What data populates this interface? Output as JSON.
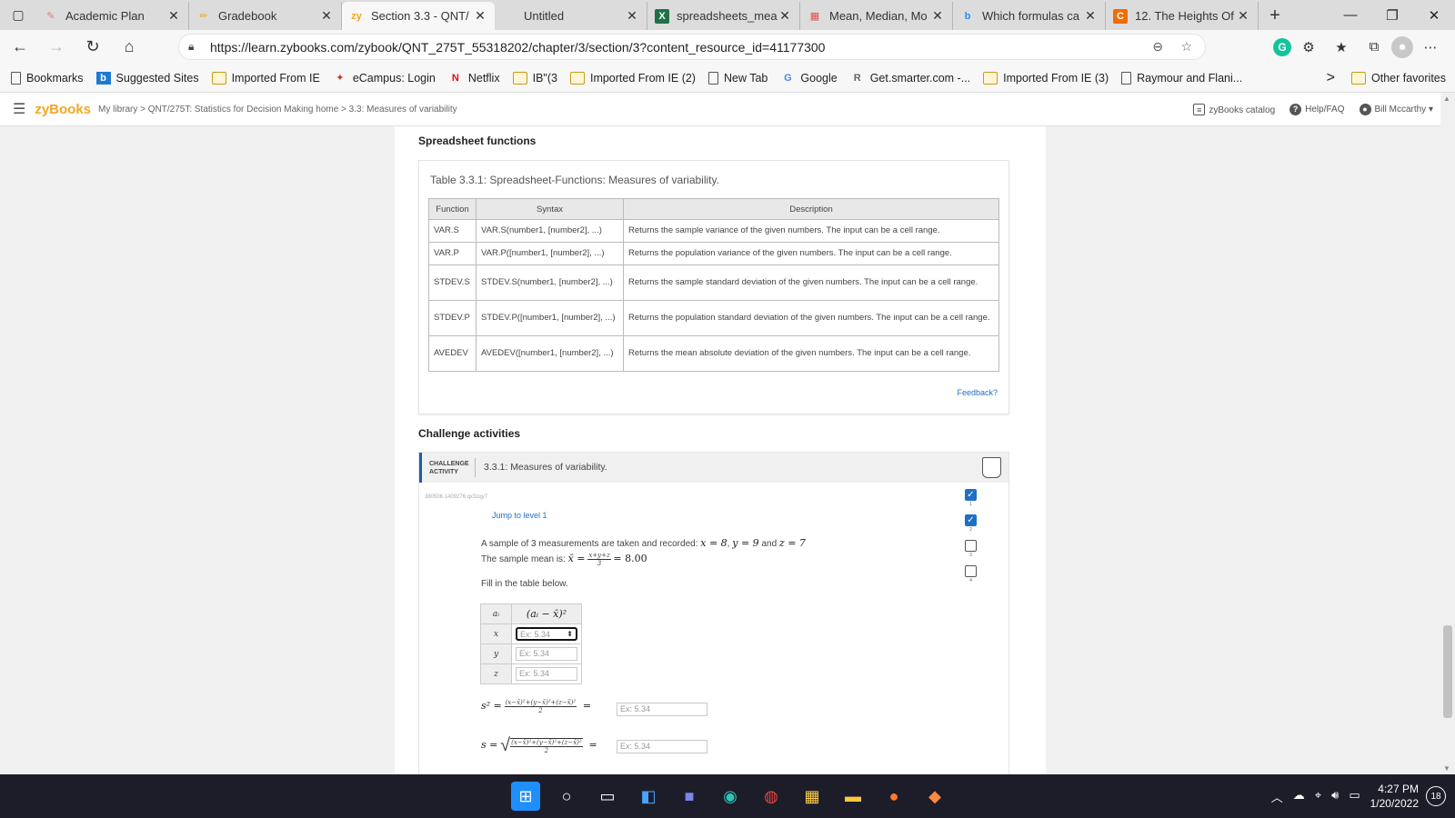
{
  "browser": {
    "tabs": [
      {
        "label": "Academic Plan",
        "icon": "feather-icon",
        "color": "#e07b7b"
      },
      {
        "label": "Gradebook",
        "icon": "pencil-icon",
        "color": "#f3a712"
      },
      {
        "label": "Section 3.3 - QNT/",
        "icon": "zy-icon",
        "color": "#f5a623",
        "active": true
      },
      {
        "label": "Untitled",
        "icon": "",
        "color": "#dcdcdc"
      },
      {
        "label": "spreadsheets_mea",
        "icon": "excel-icon",
        "color": "#1e7145"
      },
      {
        "label": "Mean, Median, Mo",
        "icon": "sheet-icon",
        "color": "#d9534f"
      },
      {
        "label": "Which formulas ca",
        "icon": "bing-icon",
        "color": "#2d8cf0"
      },
      {
        "label": "12. The Heights Of",
        "icon": "c-icon",
        "color": "#ef6c00"
      }
    ],
    "close_glyph": "✕",
    "new_tab_glyph": "+",
    "url": "https://learn.zybooks.com/zybook/QNT_275T_55318202/chapter/3/section/3?content_resource_id=41177300",
    "bookmarks": [
      {
        "label": "Bookmarks",
        "type": "page"
      },
      {
        "label": "Suggested Sites",
        "type": "bing"
      },
      {
        "label": "Imported From IE",
        "type": "folder"
      },
      {
        "label": "eCampus: Login",
        "type": "phoenix"
      },
      {
        "label": "Netflix",
        "type": "netflix"
      },
      {
        "label": "IB\"(3",
        "type": "folder"
      },
      {
        "label": "Imported From IE (2)",
        "type": "folder"
      },
      {
        "label": "New Tab",
        "type": "page"
      },
      {
        "label": "Google",
        "type": "google"
      },
      {
        "label": "Get.smarter.com -...",
        "type": "r"
      },
      {
        "label": "Imported From IE (3)",
        "type": "folder"
      },
      {
        "label": "Raymour and Flani...",
        "type": "page"
      }
    ],
    "bookmarks_more": ">",
    "other_favorites": "Other favorites"
  },
  "zy": {
    "logo": "zyBooks",
    "breadcrumb": "My library > QNT/275T: Statistics for Decision Making home > 3.3: Measures of variability",
    "catalog": "zyBooks catalog",
    "help": "Help/FAQ",
    "user": "Bill Mccarthy"
  },
  "content": {
    "spreadsheet_heading": "Spreadsheet functions",
    "table_caption": "Table 3.3.1: Spreadsheet-Functions: Measures of variability.",
    "table_headers": [
      "Function",
      "Syntax",
      "Description"
    ],
    "table_rows": [
      {
        "fn": "VAR.S",
        "syntax": "VAR.S(number1, [number2], ...)",
        "desc": "Returns the sample variance of the given numbers. The input can be a cell range."
      },
      {
        "fn": "VAR.P",
        "syntax": "VAR.P([number1, [number2], ...)",
        "desc": "Returns the population variance of the given numbers. The input can be a cell range."
      },
      {
        "fn": "STDEV.S",
        "syntax": "STDEV.S(number1, [number2], ...)",
        "desc": "Returns the sample standard deviation of the given numbers. The input can be a cell range."
      },
      {
        "fn": "STDEV.P",
        "syntax": "STDEV.P([number1, [number2], ...)",
        "desc": "Returns the population standard deviation of the given numbers. The input can be a cell range."
      },
      {
        "fn": "AVEDEV",
        "syntax": "AVEDEV([number1, [number2], ...)",
        "desc": "Returns the mean absolute deviation of the given numbers. The input can be a cell range."
      }
    ],
    "feedback": "Feedback?",
    "challenge_heading": "Challenge activities",
    "challenge_tag_1": "CHALLENGE",
    "challenge_tag_2": "ACTIVITY",
    "challenge_title": "3.3.1: Measures of variability.",
    "challenge_id": "380506.1409276.qx3zqy7",
    "jump": "Jump to level 1",
    "prob_line1": "A sample of 3 measurements are taken and recorded:",
    "x_val": "x = 8",
    "y_val": "y = 9",
    "and_word": "and",
    "z_val": "z = 7",
    "prob_line2": "The sample mean is:",
    "mean_lhs": "x̄ =",
    "mean_num": "x+y+z",
    "mean_den": "3",
    "mean_result": "= 8.00",
    "fill": "Fill in the table below.",
    "tbl_col1": "aᵢ",
    "tbl_col2": "(aᵢ − x̄)²",
    "tbl_vars": [
      "x",
      "y",
      "z"
    ],
    "placeholder": "Ex: 5.34",
    "s2_lhs": "s² =",
    "s2_num": "(x−x̄)²+(y−x̄)²+(z−x̄)²",
    "s2_den": "2",
    "eq": "=",
    "s_lhs": "s =",
    "levels": [
      {
        "num": "1",
        "done": true
      },
      {
        "num": "2",
        "done": true
      },
      {
        "num": "3",
        "done": false
      },
      {
        "num": "4",
        "done": false
      }
    ]
  },
  "taskbar": {
    "time": "4:27 PM",
    "date": "1/20/2022",
    "notifications": "18"
  }
}
